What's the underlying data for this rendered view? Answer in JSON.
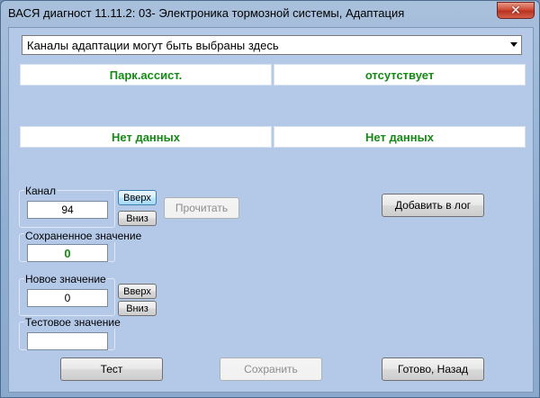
{
  "window": {
    "title": "ВАСЯ диагност 11.11.2: 03- Электроника тормозной системы, Адаптация",
    "close_glyph": "✕"
  },
  "combo": {
    "value": "Каналы адаптации могут быть выбраны здесь"
  },
  "panels": {
    "top_left": "Парк.ассист.",
    "top_right": "отсутствует",
    "bottom_left": "Нет данных",
    "bottom_right": "Нет данных"
  },
  "channel": {
    "label": "Канал",
    "value": "94",
    "up_label": "Вверх",
    "down_label": "Вниз"
  },
  "read_button": "Прочитать",
  "add_log_button": "Добавить в лог",
  "saved": {
    "label": "Сохраненное значение",
    "value": "0"
  },
  "new_value": {
    "label": "Новое значение",
    "value": "0",
    "up_label": "Вверх",
    "down_label": "Вниз"
  },
  "test_value": {
    "label": "Тестовое значение",
    "value": ""
  },
  "buttons": {
    "test": "Тест",
    "save": "Сохранить",
    "done": "Готово, Назад"
  }
}
